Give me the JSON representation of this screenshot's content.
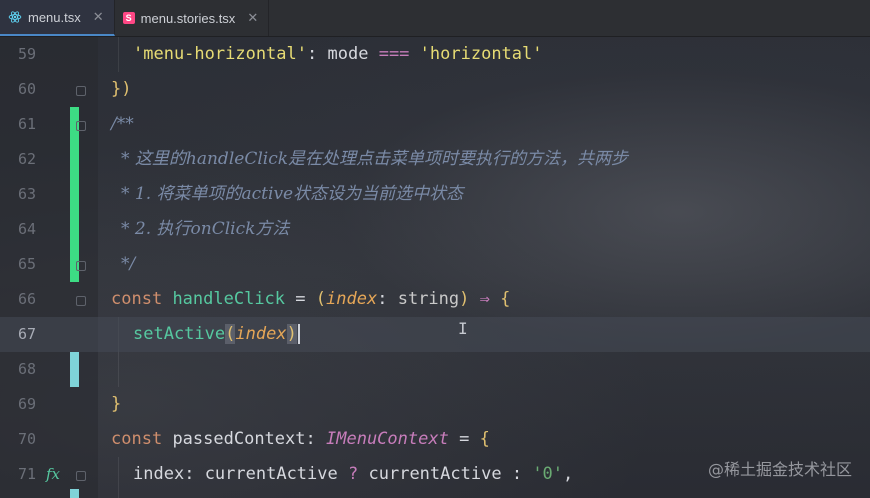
{
  "tabs": [
    {
      "label": "menu.tsx",
      "icon": "react-icon",
      "active": true
    },
    {
      "label": "menu.stories.tsx",
      "icon": "storybook-icon",
      "active": false
    }
  ],
  "editor": {
    "current_line": 67,
    "lines": [
      {
        "num": "59"
      },
      {
        "num": "60"
      },
      {
        "num": "61"
      },
      {
        "num": "62"
      },
      {
        "num": "63"
      },
      {
        "num": "64"
      },
      {
        "num": "65"
      },
      {
        "num": "66"
      },
      {
        "num": "67"
      },
      {
        "num": "68"
      },
      {
        "num": "69"
      },
      {
        "num": "70"
      },
      {
        "num": "71"
      }
    ],
    "code": {
      "l59_key": "'menu-horizontal'",
      "l59_colon": ":",
      "l59_mode": "mode",
      "l59_eq": "===",
      "l59_val": "'horizontal'",
      "l60": "})",
      "l61": "/**",
      "l62": "* 这里的handleClick是在处理点击菜单项时要执行的方法，共两步",
      "l63": "* 1. 将菜单项的active状态设为当前选中状态",
      "l64": "* 2. 执行onClick方法",
      "l65": "*/",
      "l66_const": "const",
      "l66_name": "handleClick",
      "l66_eq": "=",
      "l66_open": "(",
      "l66_param": "index",
      "l66_colon": ":",
      "l66_type": "string",
      "l66_close": ")",
      "l66_arrow": "⇒",
      "l66_brace": "{",
      "l67_fn": "setActive",
      "l67_open": "(",
      "l67_param": "index",
      "l67_close": ")",
      "l69": "}",
      "l70_const": "const",
      "l70_name": "passedContext",
      "l70_colon": ":",
      "l70_type": "IMenuContext",
      "l70_eq": "=",
      "l70_brace": "{",
      "l71_key": "index",
      "l71_colon": ":",
      "l71_a": "currentActive",
      "l71_q": "?",
      "l71_b": "currentActive",
      "l71_colon2": ":",
      "l71_val": "'0'",
      "l71_comma": ","
    }
  },
  "watermark": "@稀土掘金技术社区",
  "colors": {
    "change_bar": "#3ddc84",
    "modified_bar": "#7fd3d8",
    "tab_accent": "#4a88c7"
  }
}
